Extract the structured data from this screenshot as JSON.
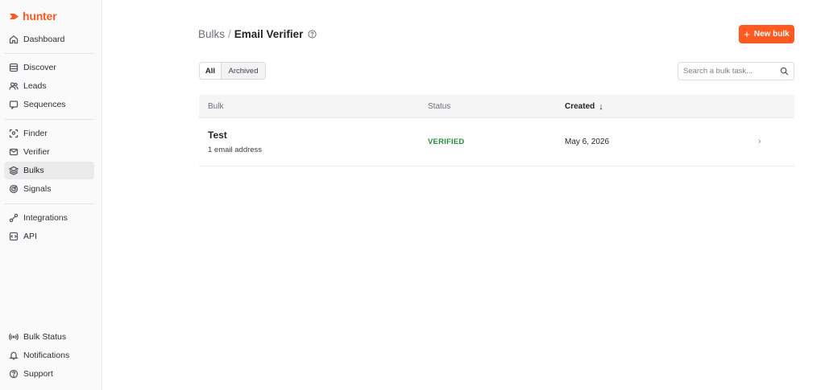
{
  "brand": {
    "name": "hunter",
    "color": "#ff5a1f"
  },
  "sidebar": {
    "primary": [
      {
        "label": "Dashboard",
        "icon": "home-icon"
      }
    ],
    "group1": [
      {
        "label": "Discover",
        "icon": "database-icon"
      },
      {
        "label": "Leads",
        "icon": "users-icon"
      },
      {
        "label": "Sequences",
        "icon": "message-icon"
      }
    ],
    "group2": [
      {
        "label": "Finder",
        "icon": "scan-face-icon"
      },
      {
        "label": "Verifier",
        "icon": "shield-check-icon"
      },
      {
        "label": "Bulks",
        "icon": "layers-icon",
        "active": true
      },
      {
        "label": "Signals",
        "icon": "radar-icon"
      }
    ],
    "group3": [
      {
        "label": "Integrations",
        "icon": "link-icon"
      },
      {
        "label": "API",
        "icon": "code-icon"
      }
    ],
    "bottom": [
      {
        "label": "Bulk Status",
        "icon": "broadcast-icon"
      },
      {
        "label": "Notifications",
        "icon": "bell-icon"
      },
      {
        "label": "Support",
        "icon": "help-circle-icon"
      }
    ]
  },
  "header": {
    "breadcrumb_parent": "Bulks",
    "breadcrumb_separator": "/",
    "breadcrumb_current": "Email Verifier",
    "new_button_label": "New bulk",
    "new_button_icon": "plus-icon"
  },
  "filters": {
    "tabs": [
      {
        "label": "All",
        "selected": true
      },
      {
        "label": "Archived",
        "selected": false
      }
    ]
  },
  "search": {
    "placeholder": "Search a bulk task...",
    "value": ""
  },
  "table": {
    "columns": {
      "bulk": "Bulk",
      "status": "Status",
      "created": "Created",
      "sort_indicator": "↓"
    },
    "rows": [
      {
        "name": "Test",
        "detail": "1 email address",
        "status": "VERIFIED",
        "created": "May 6, 2026"
      }
    ]
  },
  "colors": {
    "accent": "#ff5a1f",
    "status_verified": "#2b8a3e"
  }
}
